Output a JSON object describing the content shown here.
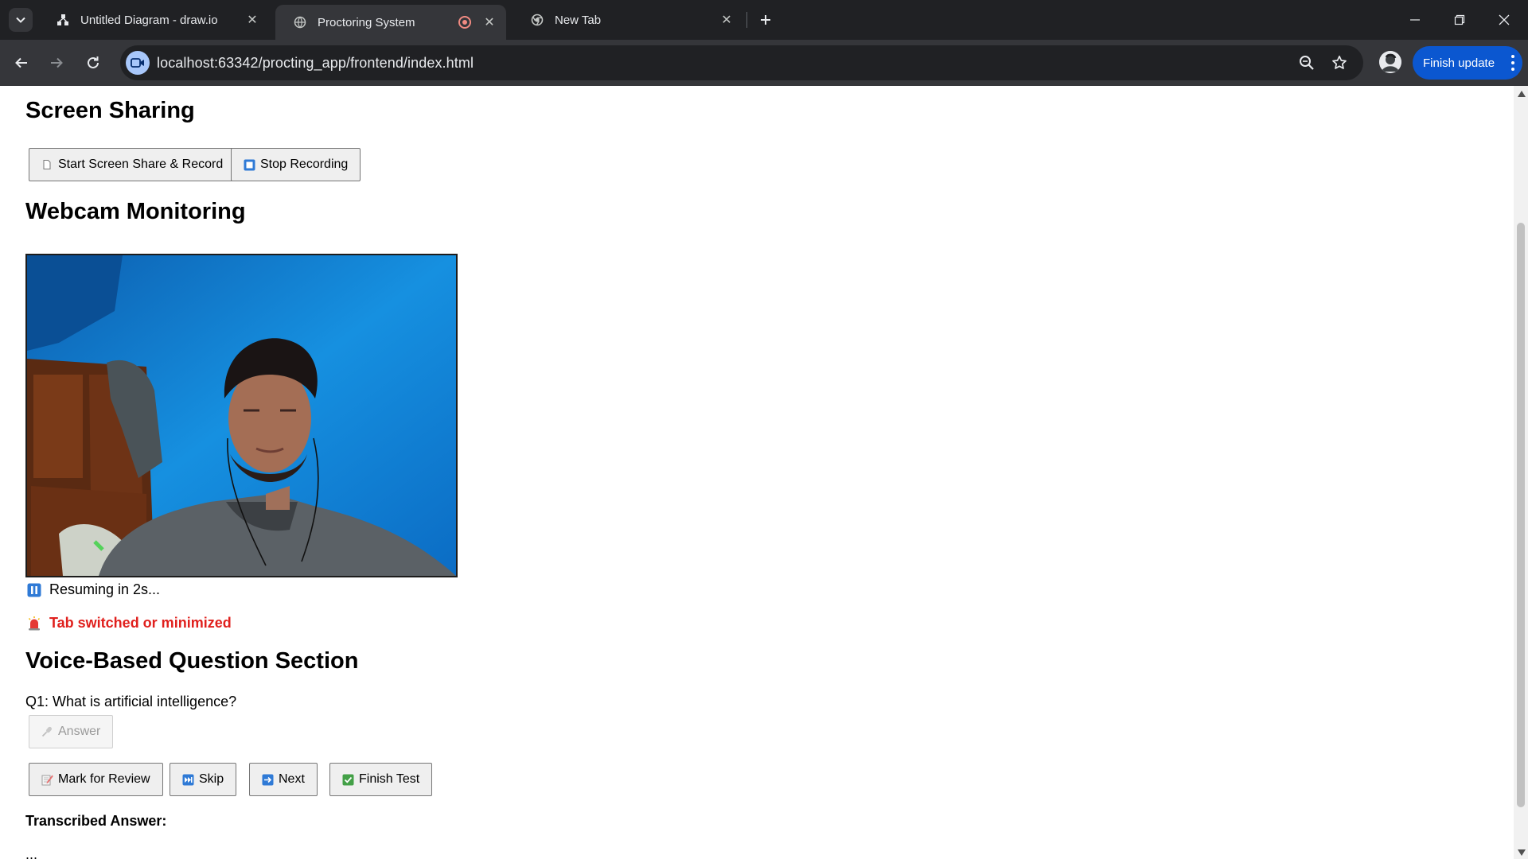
{
  "browser": {
    "tabs": [
      {
        "title": "Untitled Diagram - draw.io",
        "active": false
      },
      {
        "title": "Proctoring System",
        "active": true,
        "recording": true
      },
      {
        "title": "New Tab",
        "active": false
      }
    ],
    "url": "localhost:63342/procting_app/frontend/index.html",
    "update_label": "Finish update"
  },
  "screen_sharing": {
    "heading": "Screen Sharing",
    "start_label": "Start Screen Share & Record",
    "stop_label": "Stop Recording"
  },
  "webcam": {
    "heading": "Webcam Monitoring",
    "status_text": "Resuming in 2s...",
    "alert_text": "Tab switched or minimized"
  },
  "voice": {
    "heading": "Voice-Based Question Section",
    "question": "Q1: What is artificial intelligence?",
    "answer_label": "Answer",
    "mark_label": "Mark for Review",
    "skip_label": "Skip",
    "next_label": "Next",
    "finish_label": "Finish Test",
    "transcribed_label": "Transcribed Answer:",
    "transcribed_value": "..."
  },
  "colors": {
    "alert": "#e0201d",
    "update_button": "#0b57d0",
    "webcam_background": "#0f84d8"
  }
}
